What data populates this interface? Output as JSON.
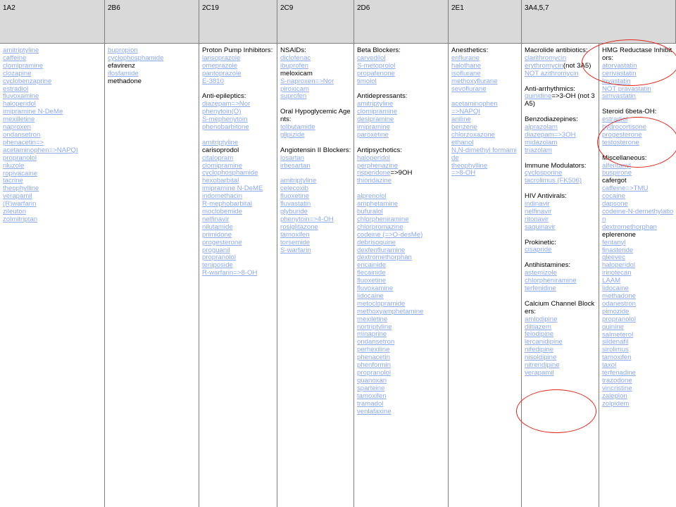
{
  "headers": [
    "1A2",
    "2B6",
    "2C19",
    "2C9",
    "2D6",
    "2E1",
    "3A4,5,7"
  ],
  "columns": [
    [
      {
        "t": "amitriptyline",
        "l": true
      },
      {
        "t": "caffeine",
        "l": true
      },
      {
        "t": "clomipramine",
        "l": true
      },
      {
        "t": "clozapine",
        "l": true
      },
      {
        "t": "cyclobenzaprine",
        "l": true
      },
      {
        "t": "estradiol",
        "l": true
      },
      {
        "t": "fluvoxamine",
        "l": true
      },
      {
        "t": "haloperidol",
        "l": true
      },
      {
        "t": "imipramine N-DeMe",
        "l": true
      },
      {
        "t": "mexilletine",
        "l": true
      },
      {
        "t": "naproxen",
        "l": true
      },
      {
        "t": "ondansetron",
        "l": true
      },
      {
        "t": "phenacetin=>",
        "l": true
      },
      {
        "t": "acetaminophen=>NAPQI",
        "l": true
      },
      {
        "t": "propranolol",
        "l": true
      },
      {
        "t": "riluzole",
        "l": true
      },
      {
        "t": "ropivacaine",
        "l": true
      },
      {
        "t": "tacrine",
        "l": true
      },
      {
        "t": "theophylline",
        "l": true
      },
      {
        "t": "verapamil",
        "l": true
      },
      {
        "t": "(R)warfarin",
        "l": true
      },
      {
        "t": "zileuton",
        "l": true
      },
      {
        "t": "zolmitriptan",
        "l": true
      }
    ],
    [
      {
        "t": "bupropion",
        "l": true
      },
      {
        "t": "cyclophosphamide",
        "l": true
      },
      {
        "t": "efavirenz",
        "l": false
      },
      {
        "t": "ifosfamide",
        "l": true
      },
      {
        "t": "methadone",
        "l": false
      }
    ],
    [
      {
        "t": "Proton Pump Inhibitors:",
        "l": false
      },
      {
        "t": "lansoprazole",
        "l": true
      },
      {
        "t": "omeprazole",
        "l": true
      },
      {
        "t": "pantoprazole",
        "l": true
      },
      {
        "t": "E-3810",
        "l": true
      },
      {
        "gap": true
      },
      {
        "t": "Anti-epileptics:",
        "l": false
      },
      {
        "t": "diazepam=>Nor",
        "l": true
      },
      {
        "t": "phenytoin(O)",
        "l": true
      },
      {
        "t": "S-mephenytoin",
        "l": true
      },
      {
        "t": "phenobarbitone",
        "l": true
      },
      {
        "gap": true
      },
      {
        "t": "amitriptyline",
        "l": true
      },
      {
        "t": "carisoprodol",
        "l": false
      },
      {
        "t": "citalopram",
        "l": true
      },
      {
        "t": "clomipramine",
        "l": true
      },
      {
        "t": "cyclophosphamide",
        "l": true
      },
      {
        "t": "hexobarbital",
        "l": true
      },
      {
        "t": "imipramine N-DeME",
        "l": true
      },
      {
        "t": "indomethacin",
        "l": true
      },
      {
        "t": "R-mephobarbital",
        "l": true
      },
      {
        "t": "moclobemide",
        "l": true
      },
      {
        "t": "nelfinavir",
        "l": true
      },
      {
        "t": "nilutamide",
        "l": true
      },
      {
        "t": "primidone",
        "l": true
      },
      {
        "t": "progesterone",
        "l": true
      },
      {
        "t": "proguanil",
        "l": true
      },
      {
        "t": "propranolol",
        "l": true
      },
      {
        "t": "teniposide",
        "l": true
      },
      {
        "t": "R-warfarin=>8-OH",
        "l": true
      }
    ],
    [
      {
        "t": "NSAIDs:",
        "l": false
      },
      {
        "t": "diclofenac",
        "l": true
      },
      {
        "t": "ibuprofen",
        "l": true
      },
      {
        "t": "meloxicam",
        "l": false
      },
      {
        "t": "S-naproxen=>Nor",
        "l": true
      },
      {
        "t": "piroxicam",
        "l": true
      },
      {
        "t": "suprofen",
        "l": true
      },
      {
        "gap": true
      },
      {
        "t": "Oral Hypoglycemic Agents:",
        "l": false
      },
      {
        "t": "tolbutamide",
        "l": true
      },
      {
        "t": "glipizide",
        "l": true
      },
      {
        "gap": true
      },
      {
        "t": "Angiotensin II Blockers:",
        "l": false
      },
      {
        "t": "losartan",
        "l": true
      },
      {
        "t": "irbesartan",
        "l": true
      },
      {
        "gap": true
      },
      {
        "t": "amitriptyline",
        "l": true
      },
      {
        "t": "celecoxib",
        "l": true
      },
      {
        "t": "fluoxetine",
        "l": true
      },
      {
        "t": "fluvastatin",
        "l": true
      },
      {
        "t": "glyburide",
        "l": true
      },
      {
        "t": "phenytoin=>4-OH",
        "l": true
      },
      {
        "t": "rosiglitazone",
        "l": true
      },
      {
        "t": "tamoxifen",
        "l": true
      },
      {
        "t": "torsemide",
        "l": true
      },
      {
        "t": "S-warfarin",
        "l": true
      }
    ],
    [
      {
        "t": "Beta Blockers:",
        "l": false
      },
      {
        "t": "carvedilol",
        "l": true
      },
      {
        "t": "S-metoprolol",
        "l": true
      },
      {
        "t": "propafenone",
        "l": true
      },
      {
        "t": "timolol",
        "l": true
      },
      {
        "gap": true
      },
      {
        "t": "Antidepressants:",
        "l": false
      },
      {
        "t": "amitriptyline",
        "l": true
      },
      {
        "t": "clomipramine",
        "l": true
      },
      {
        "t": "desipramine",
        "l": true
      },
      {
        "t": "imipramine",
        "l": true
      },
      {
        "t": "paroxetine",
        "l": true
      },
      {
        "gap": true
      },
      {
        "t": "Antipsychotics:",
        "l": false
      },
      {
        "t": "haloperidol",
        "l": true
      },
      {
        "t": "perphenazine",
        "l": true
      },
      {
        "t": "risperidone",
        "l": true,
        "s": "=>9OH"
      },
      {
        "t": "thioridazine",
        "l": true
      },
      {
        "gap": true
      },
      {
        "t": "alprenolol",
        "l": true
      },
      {
        "t": "amphetamine",
        "l": true
      },
      {
        "t": "bufuralol",
        "l": true
      },
      {
        "t": "chlorpheniramine",
        "l": true
      },
      {
        "t": "chlorpromazine",
        "l": true
      },
      {
        "t": "codeine (=>O-desMe)",
        "l": true
      },
      {
        "t": "debrisoquine",
        "l": true
      },
      {
        "t": "dexfenfluramine",
        "l": true
      },
      {
        "t": "dextromethorphan",
        "l": true
      },
      {
        "t": "encainide",
        "l": true
      },
      {
        "t": "flecainide",
        "l": true
      },
      {
        "t": "fluoxetine",
        "l": true
      },
      {
        "t": "fluvoxamine",
        "l": true
      },
      {
        "t": "lidocaine",
        "l": true
      },
      {
        "t": "metoclopramide",
        "l": true
      },
      {
        "t": "methoxyamphetamine",
        "l": true
      },
      {
        "t": "mexiletine",
        "l": true
      },
      {
        "t": "nortriptyline",
        "l": true
      },
      {
        "t": "minaprine",
        "l": true
      },
      {
        "t": "ondansetron",
        "l": true
      },
      {
        "t": "perhexiline",
        "l": true
      },
      {
        "t": "phenacetin",
        "l": true
      },
      {
        "t": "phenformin",
        "l": true
      },
      {
        "t": "propranolol",
        "l": true
      },
      {
        "t": "quanoxan",
        "l": true
      },
      {
        "t": "sparteine",
        "l": true
      },
      {
        "t": "tamoxifen",
        "l": true
      },
      {
        "t": "tramadol",
        "l": true
      },
      {
        "t": "venlafaxine",
        "l": true
      }
    ],
    [
      {
        "t": "Anesthetics:",
        "l": false
      },
      {
        "t": "enflurane",
        "l": true
      },
      {
        "t": "halothane",
        "l": true
      },
      {
        "t": "isoflurane",
        "l": true
      },
      {
        "t": "methoxyflurane",
        "l": true
      },
      {
        "t": "sevoflurane",
        "l": true
      },
      {
        "gap": true
      },
      {
        "t": "acetaminophen",
        "l": true
      },
      {
        "t": " =>NAPQI",
        "l": true
      },
      {
        "t": "aniline",
        "l": true
      },
      {
        "t": "benzene",
        "l": true
      },
      {
        "t": "chlorzoxazone",
        "l": true
      },
      {
        "t": "ethanol",
        "l": true
      },
      {
        "t": "N,N-dimethyl formamide",
        "l": true
      },
      {
        "t": "theophylline",
        "l": true
      },
      {
        "t": "=>8-OH",
        "l": true
      }
    ],
    [
      {
        "t": "Macrolide antibiotics:",
        "l": false
      },
      {
        "t": "clarithromycin",
        "l": true
      },
      {
        "t": "erythromycin",
        "l": true,
        "s": "(not 3A5)"
      },
      {
        "t": "NOT azithromycin",
        "l": true
      },
      {
        "gap": true
      },
      {
        "t": "Anti-arrhythmics:",
        "l": false
      },
      {
        "t": "quinidine",
        "l": true,
        "s": "=>3-OH (not 3A5)"
      },
      {
        "gap": true
      },
      {
        "t": "Benzodiazepines:",
        "l": false
      },
      {
        "t": "alprazolam",
        "l": true
      },
      {
        "t": "diazepam=>3OH",
        "l": true
      },
      {
        "t": "midazolam",
        "l": true
      },
      {
        "t": "triazolam",
        "l": true
      },
      {
        "gap": true
      },
      {
        "t": "Immune Modulators:",
        "l": false
      },
      {
        "t": "cyclosporine",
        "l": true
      },
      {
        "t": "tacrolimus (FK506)",
        "l": true
      },
      {
        "gap": true
      },
      {
        "t": "HIV Antivirals:",
        "l": false
      },
      {
        "t": "indinavir",
        "l": true
      },
      {
        "t": "nelfinavir",
        "l": true
      },
      {
        "t": "ritonavir",
        "l": true
      },
      {
        "t": "saquinavir",
        "l": true
      },
      {
        "gap": true
      },
      {
        "t": "Prokinetic:",
        "l": false
      },
      {
        "t": "cisapride",
        "l": true
      },
      {
        "gap": true
      },
      {
        "t": "Antihistamines:",
        "l": false
      },
      {
        "t": "astemizole",
        "l": true
      },
      {
        "t": "chlorpheniramine",
        "l": true
      },
      {
        "t": "terfenidine",
        "l": true
      },
      {
        "gap": true
      },
      {
        "t": "Calcium Channel Blockers:",
        "l": false
      },
      {
        "t": "amlodipine",
        "l": true
      },
      {
        "t": "diltiazem",
        "l": true
      },
      {
        "t": "felodipine",
        "l": true
      },
      {
        "t": "lercanidipine",
        "l": true
      },
      {
        "t": "nifedipine",
        "l": true
      },
      {
        "t": "nisoldipine",
        "l": true
      },
      {
        "t": "nitrendipine",
        "l": true
      },
      {
        "t": "verapamil",
        "l": true
      }
    ],
    [
      {
        "t": "HMG Reductase Inhibitors:",
        "l": false
      },
      {
        "t": "atorvastatin",
        "l": true
      },
      {
        "t": "cerivastatin",
        "l": true
      },
      {
        "t": "lovastatin",
        "l": true
      },
      {
        "t": "NOT pravastatin",
        "l": true
      },
      {
        "t": "simvastatin",
        "l": true
      },
      {
        "gap": true
      },
      {
        "t": "Steroid 6beta-OH:",
        "l": false
      },
      {
        "t": "estradiol",
        "l": true
      },
      {
        "t": "hydrocortisone",
        "l": true
      },
      {
        "t": "progesterone",
        "l": true
      },
      {
        "t": "testosterone",
        "l": true
      },
      {
        "gap": true
      },
      {
        "t": "Miscellaneous:",
        "l": false
      },
      {
        "t": "alfentanyl",
        "l": true
      },
      {
        "t": "buspirone",
        "l": true
      },
      {
        "t": "cafergot",
        "l": false
      },
      {
        "t": "caffeine=>TMU",
        "l": true
      },
      {
        "t": "cocaine",
        "l": true
      },
      {
        "t": "dapsone",
        "l": true
      },
      {
        "t": "codeine-N-demethylation",
        "l": true
      },
      {
        "t": "dextromethorphan",
        "l": true
      },
      {
        "t": "eplerenone",
        "l": false
      },
      {
        "t": "fentanyl",
        "l": true
      },
      {
        "t": "finasteride",
        "l": true
      },
      {
        "t": "gleevec",
        "l": true
      },
      {
        "t": "haloperidol",
        "l": true
      },
      {
        "t": "irinotecan",
        "l": true
      },
      {
        "t": "LAAM",
        "l": true
      },
      {
        "t": "lidocaine",
        "l": true
      },
      {
        "t": "methadone",
        "l": true
      },
      {
        "t": "odanestron",
        "l": true
      },
      {
        "t": "pimozide",
        "l": true
      },
      {
        "t": "propranolol",
        "l": true
      },
      {
        "t": "quinine",
        "l": true
      },
      {
        "t": "salmeterol",
        "l": true
      },
      {
        "t": "sildenafil",
        "l": true
      },
      {
        "t": "sirolimus",
        "l": true
      },
      {
        "t": "tamoxifen",
        "l": true
      },
      {
        "t": "taxol",
        "l": true
      },
      {
        "t": "terfenadine",
        "l": true
      },
      {
        "t": "trazodone",
        "l": true
      },
      {
        "t": "vincristine",
        "l": true
      },
      {
        "t": "zaleplon",
        "l": true
      },
      {
        "t": "zolpidem",
        "l": true
      }
    ]
  ],
  "annotation_color": "#e0261a",
  "link_color": "#8ea9e8"
}
